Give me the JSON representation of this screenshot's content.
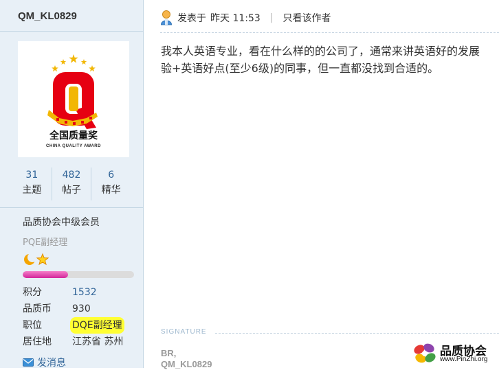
{
  "user": {
    "username": "QM_KL0829",
    "avatar": {
      "text_cn": "全国质量奖",
      "text_en": "CHINA QUALITY AWARD",
      "accent": "#e60012",
      "gold": "#f2b705"
    },
    "stats": [
      {
        "value": "31",
        "label": "主题"
      },
      {
        "value": "482",
        "label": "帖子"
      },
      {
        "value": "6",
        "label": "精华"
      }
    ],
    "group": "品质协会中级会员",
    "title": "PQE副经理",
    "rank_icons": [
      "moon-icon",
      "star-icon"
    ],
    "level_progress": 0.41,
    "profile": [
      {
        "label": "积分",
        "value": "1532",
        "link": true
      },
      {
        "label": "品质币",
        "value": "930",
        "link": false
      },
      {
        "label": "职位",
        "value": "DQE副经理",
        "link": false,
        "highlight": true
      },
      {
        "label": "居住地",
        "value": "江苏省 苏州",
        "link": false
      }
    ],
    "send_message": "发消息"
  },
  "post": {
    "posted_prefix": "发表于",
    "posted_time": "昨天 11:53",
    "author_only": "只看该作者",
    "lines": [
      "我本人英语专业，看在什么样的的公司了，通常来讲英语好的发展",
      "验+英语好点(至少6级)的同事，但一直都没找到合适的。"
    ]
  },
  "signature": {
    "label": "SIGNATURE",
    "lines": [
      "BR,",
      "QM_KL0829"
    ]
  },
  "watermark": {
    "name": "品质协会",
    "url": "www.PinZhi.org"
  },
  "colors": {
    "sidebar_bg": "#e8f0f7",
    "border": "#c2d5e3",
    "link": "#336699",
    "progress": "#e0489f",
    "highlight": "#ffff33"
  }
}
